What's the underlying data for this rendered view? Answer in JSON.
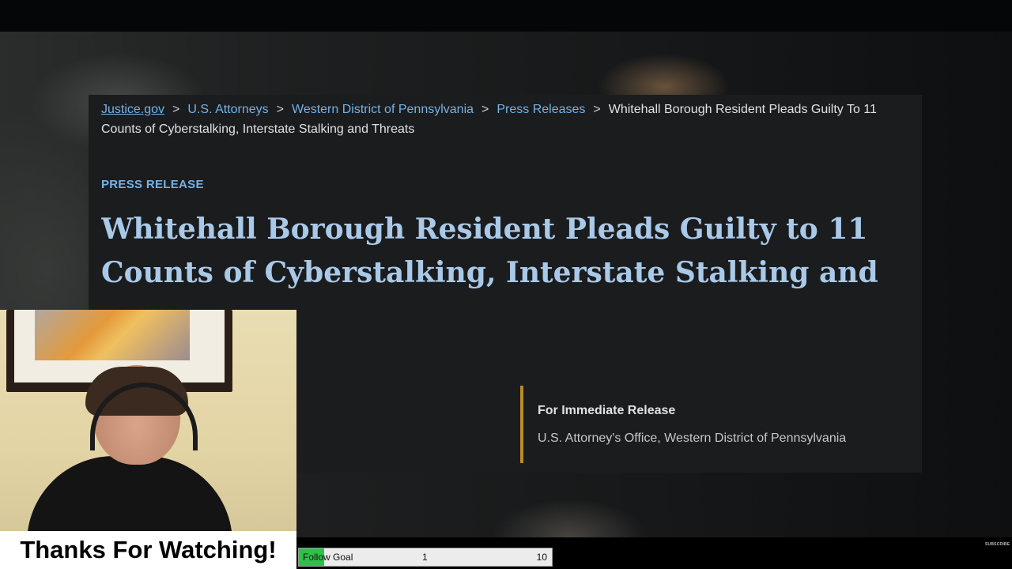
{
  "breadcrumb": {
    "items": [
      "Justice.gov",
      "U.S. Attorneys",
      "Western District of Pennsylvania",
      "Press Releases"
    ],
    "separator": ">",
    "current": "Whitehall Borough Resident Pleads Guilty To 11 Counts of Cyberstalking, Interstate Stalking and Threats"
  },
  "article": {
    "eyebrow": "PRESS RELEASE",
    "title": "Whitehall Borough Resident Pleads Guilty to 11 Counts of Cyberstalking, Interstate Stalking and Threats",
    "release_label": "For Immediate Release",
    "office": "U.S. Attorney's Office, Western District of Pennsylvania"
  },
  "overlay": {
    "thanks_text": "Thanks For Watching!",
    "goal": {
      "label": "Follow Goal",
      "current": "1",
      "target": "10",
      "progress": 0.1
    },
    "subscribe": "SUBSCRIBE"
  },
  "colors": {
    "link": "#73b3e7",
    "headline": "#a9c9e8",
    "accent_border": "#b98a2b",
    "goal_fill": "#2fc04a"
  }
}
